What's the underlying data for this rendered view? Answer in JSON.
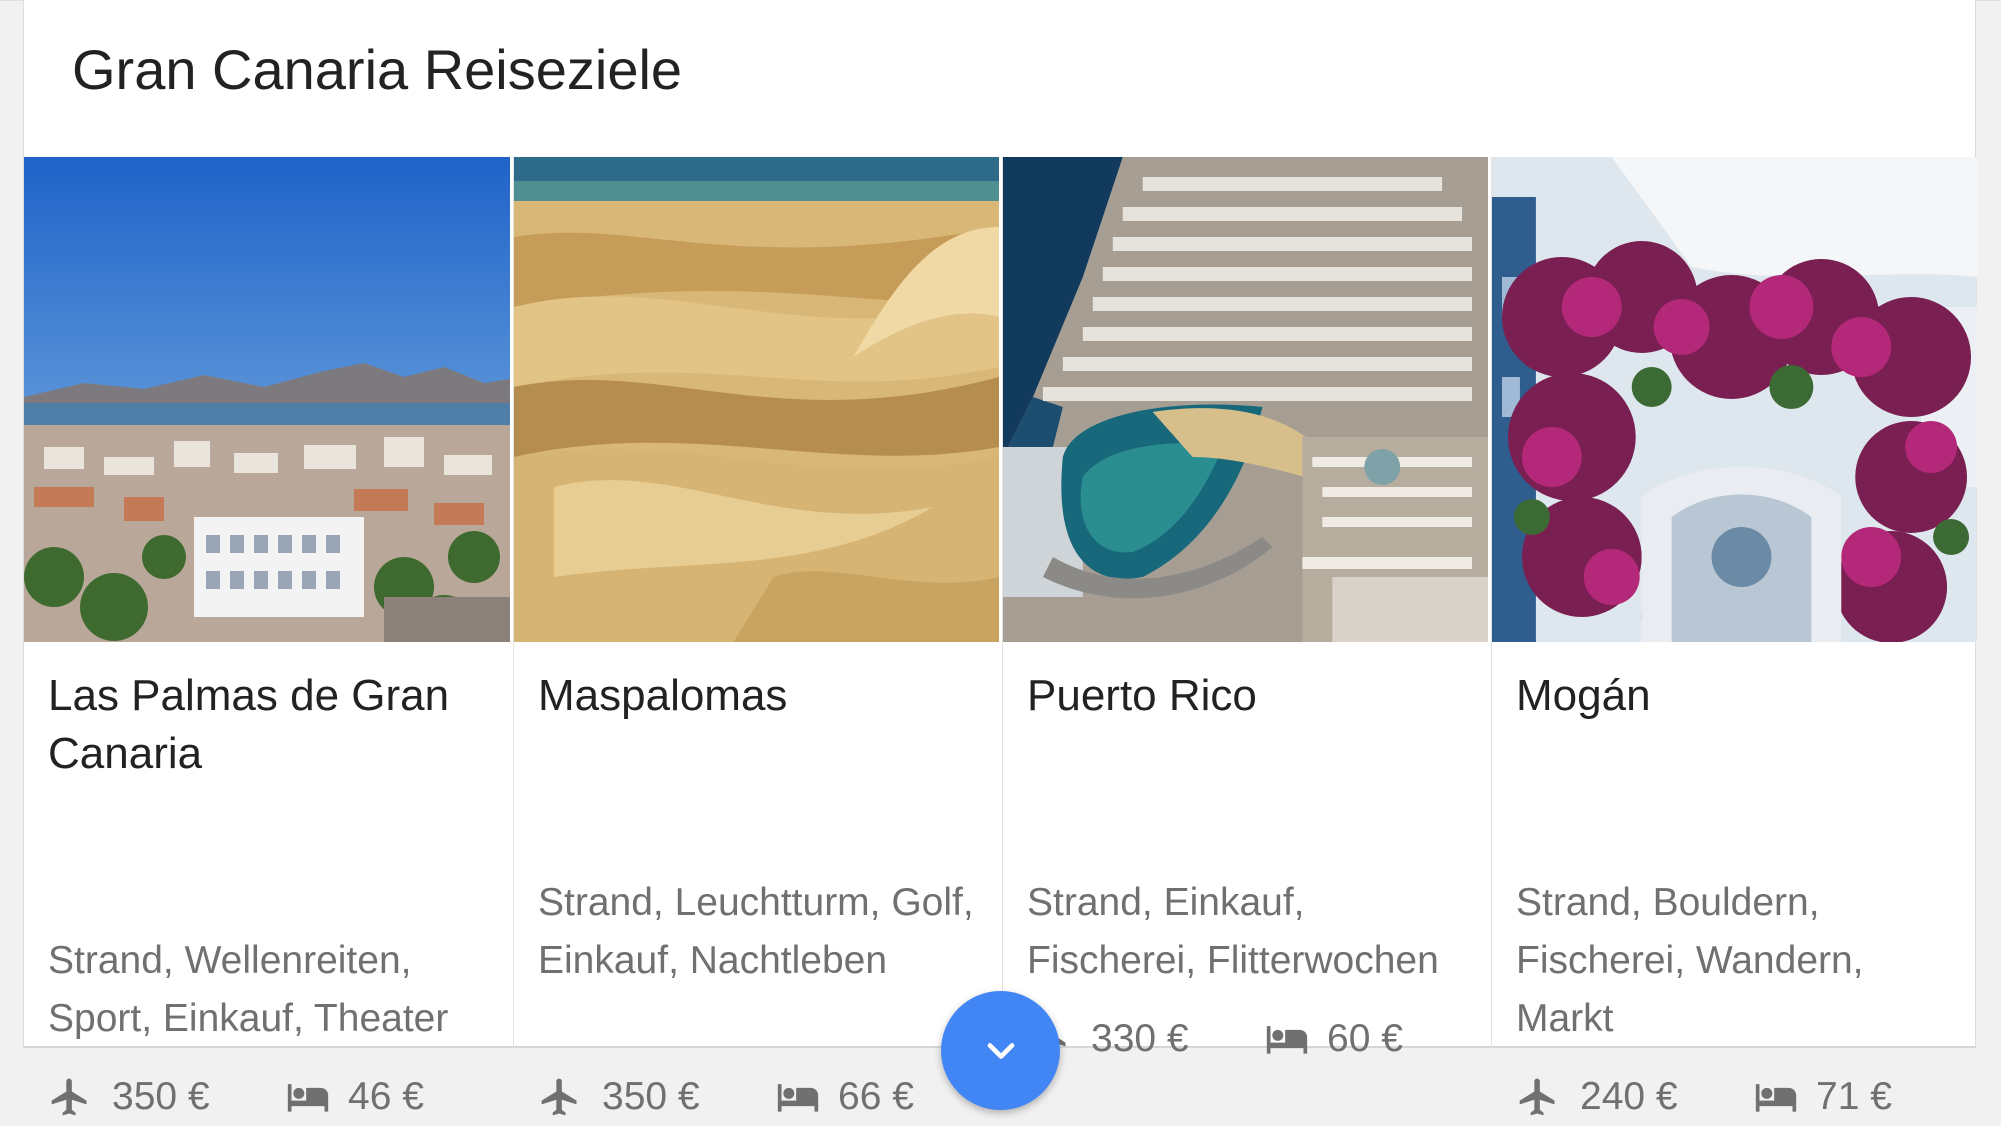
{
  "card": {
    "title": "Gran Canaria Reiseziele"
  },
  "destinations": [
    {
      "name": "Las Palmas de Gran Canaria",
      "tags": "Strand, Wellenreiten, Sport, Einkauf, Theater",
      "flight_price": "350 €",
      "hotel_price": "46 €",
      "image": "city-coast-photo"
    },
    {
      "name": "Maspalomas",
      "tags": "Strand, Leuchtturm, Golf, Einkauf, Nachtleben",
      "flight_price": "350 €",
      "hotel_price": "66 €",
      "image": "sand-dunes-photo"
    },
    {
      "name": "Puerto Rico",
      "tags": "Strand, Einkauf, Fischerei, Flitterwochen",
      "flight_price": "330 €",
      "hotel_price": "60 €",
      "image": "bay-marina-photo"
    },
    {
      "name": "Mogán",
      "tags": "Strand, Bouldern, Fischerei, Wandern, Markt",
      "flight_price": "240 €",
      "hotel_price": "71 €",
      "image": "bougainvillea-arch-photo"
    }
  ],
  "icons": {
    "flight": "airplane-icon",
    "hotel": "bed-icon",
    "expand": "chevron-down-icon"
  },
  "colors": {
    "accent": "#4285f4",
    "title_text": "#222222",
    "secondary_text": "#707070"
  }
}
